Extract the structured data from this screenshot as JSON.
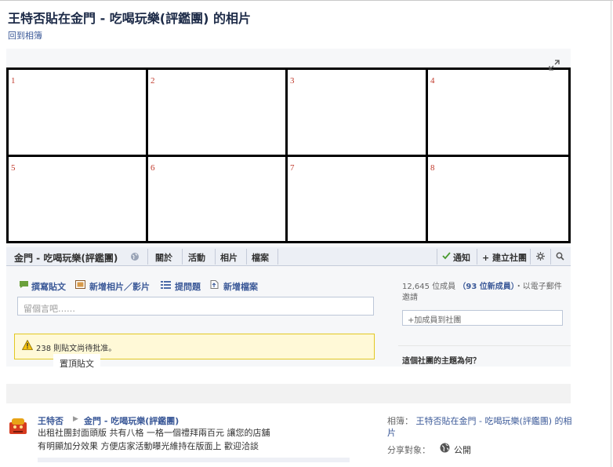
{
  "page": {
    "title": "王特否貼在金門 - 吃喝玩樂(評鑑團) 的相片",
    "back_link": "回到相簿"
  },
  "photo": {
    "grid_labels": [
      "1",
      "2",
      "3",
      "4",
      "5",
      "6",
      "7",
      "8"
    ],
    "group_name": "金門 - 吃喝玩樂(評鑑團)",
    "tabs": [
      {
        "label": "關於"
      },
      {
        "label": "活動"
      },
      {
        "label": "相片"
      },
      {
        "label": "檔案"
      }
    ],
    "notify_label": "通知",
    "create_group_label": "+ 建立社團",
    "composer": {
      "post": "撰寫貼文",
      "photo_video": "新增相片／影片",
      "question": "提問題",
      "file": "新增檔案",
      "placeholder": "留個言吧……"
    },
    "pending": "238 則貼文尚待批准。",
    "pinned": "置頂貼文",
    "members": {
      "count_text": "12,645 位成員",
      "new_text": "（93 位新成員）",
      "invite_text": "・以電子郵件邀請"
    },
    "add_member": "+加成員到社團",
    "topic_question": "這個社團的主題為何？"
  },
  "post": {
    "author": "王特否",
    "arrow": "▶",
    "group": "金門 - 吃喝玩樂(評鑑團)",
    "body_line1": "出租社團封面頭版 共有八格 一格一個禮拜兩百元 讓您的店舖",
    "body_line2": "有明顯加分效果 方便店家活動曝光維持在版面上 歡迎洽談"
  },
  "sidebar": {
    "album_prefix": "相簿：",
    "album_name": "王特否貼在金門 - 吃喝玩樂(評鑑團) 的相片",
    "share_label": "分享對象：",
    "share_value": "公開"
  },
  "colors": {
    "link_blue": "#3b5998",
    "grid_number": "#c0392b",
    "pending_bg": "#fff9d7"
  }
}
